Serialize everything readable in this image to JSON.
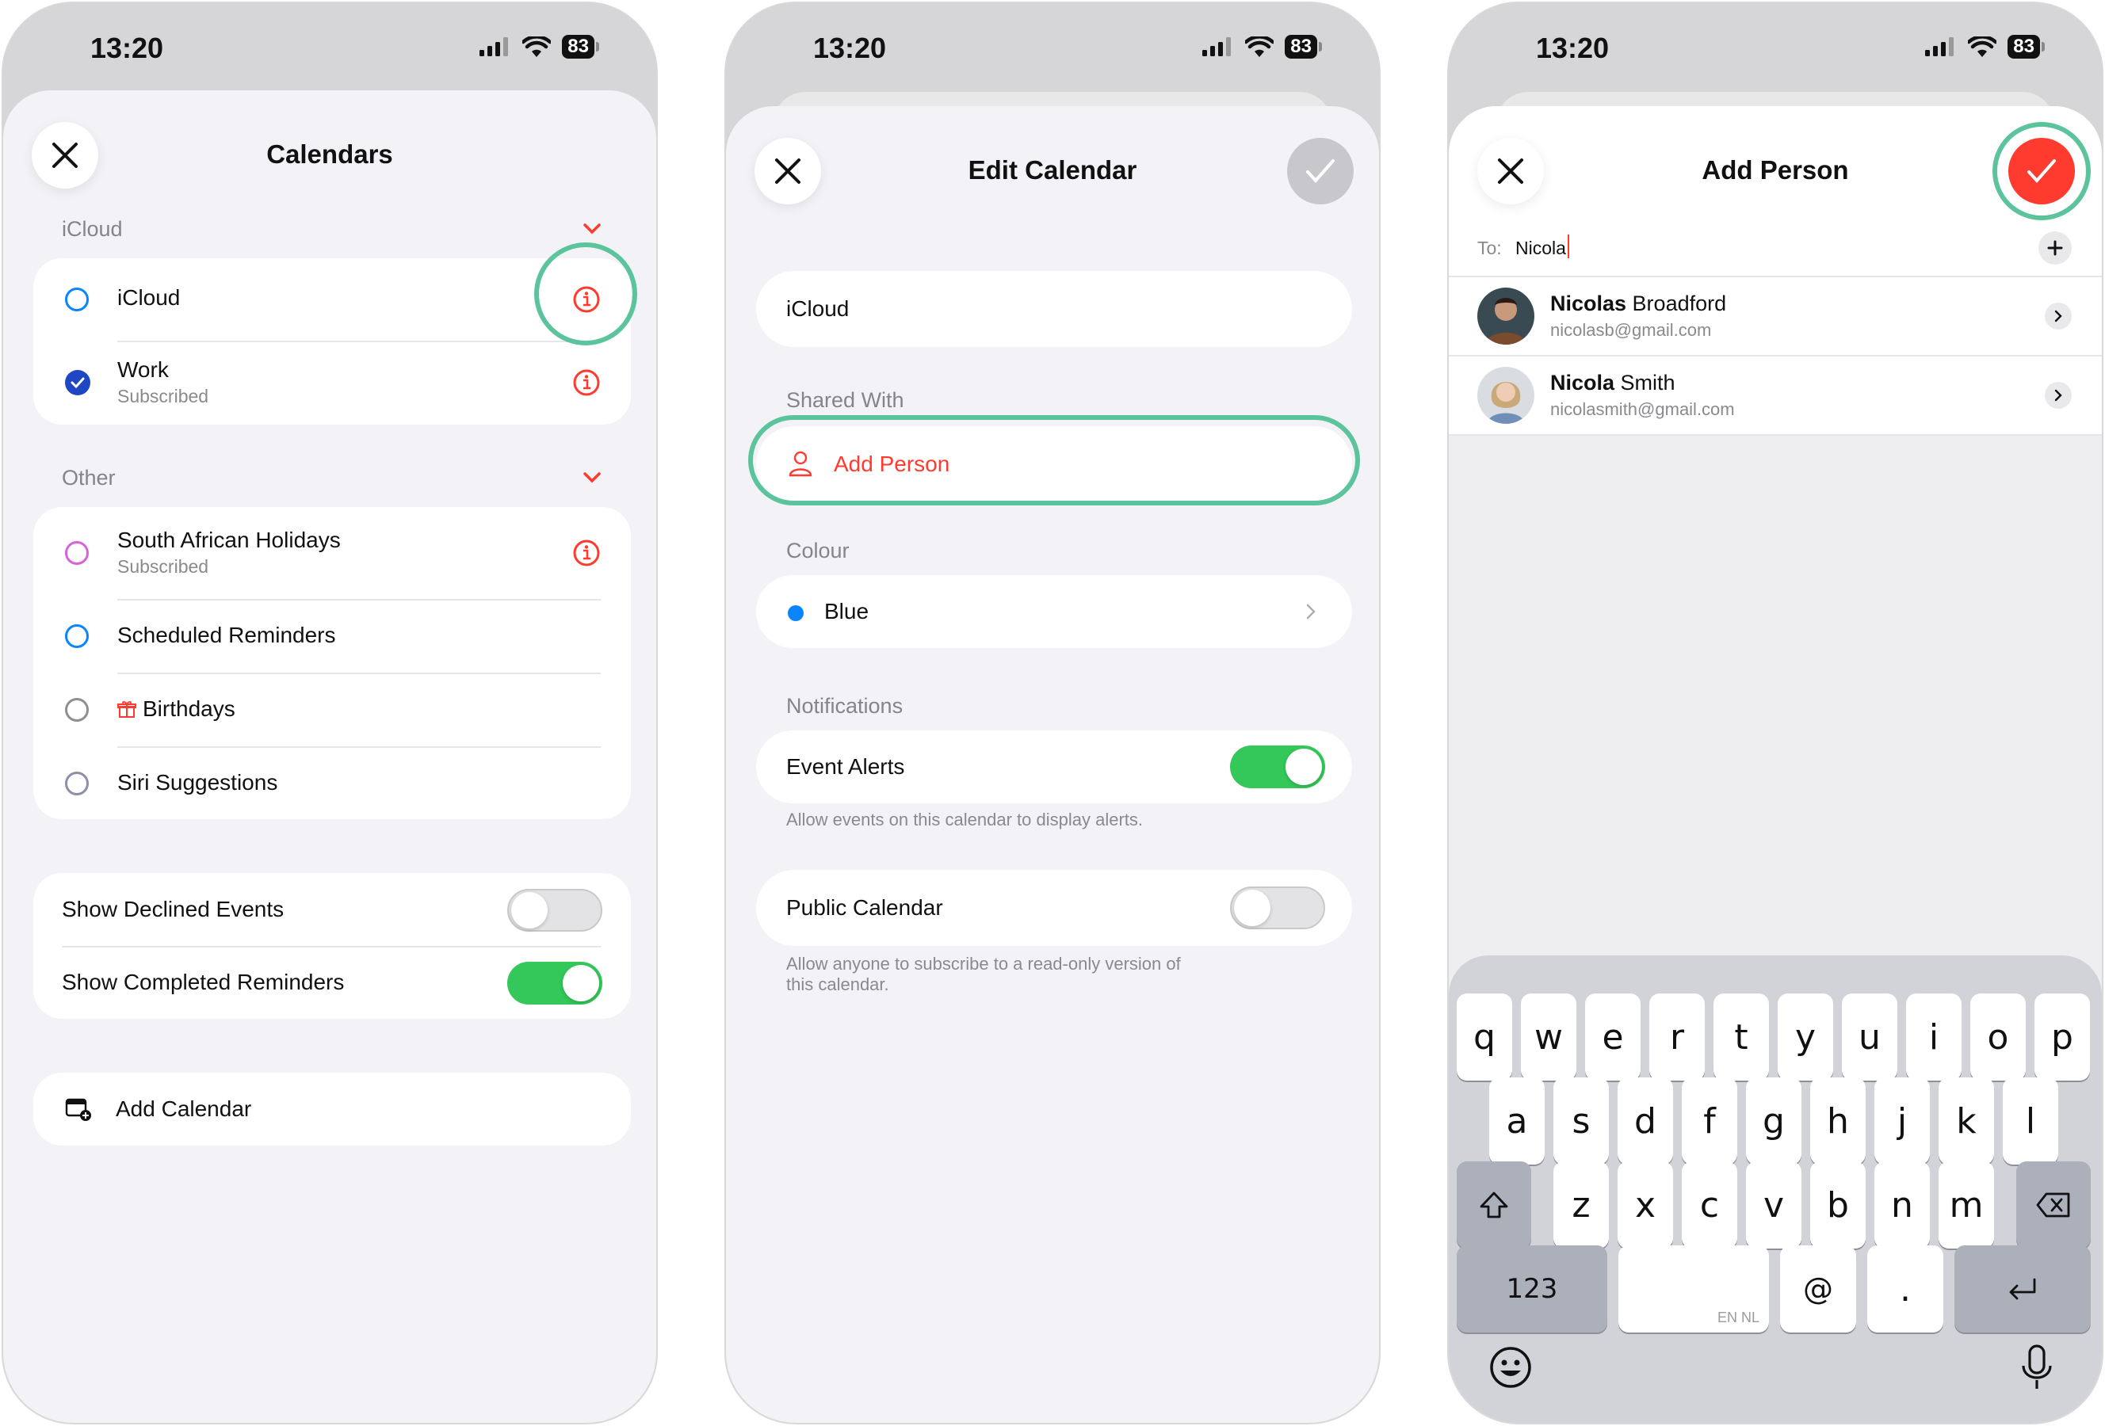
{
  "status": {
    "time": "13:20",
    "battery": "83"
  },
  "calendars": {
    "title": "Calendars",
    "icloud_section": "iCloud",
    "icloud_items": [
      {
        "label": "iCloud",
        "sub": ""
      },
      {
        "label": "Work",
        "sub": "Subscribed"
      }
    ],
    "other_section": "Other",
    "other_items": [
      {
        "label": "South African Holidays",
        "sub": "Subscribed"
      },
      {
        "label": "Scheduled Reminders",
        "sub": ""
      },
      {
        "label": "Birthdays",
        "sub": ""
      },
      {
        "label": "Siri Suggestions",
        "sub": ""
      }
    ],
    "toggles": [
      {
        "label": "Show Declined Events",
        "on": false
      },
      {
        "label": "Show Completed Reminders",
        "on": true
      }
    ],
    "add_calendar": "Add Calendar"
  },
  "edit_calendar": {
    "title": "Edit Calendar",
    "name_value": "iCloud",
    "shared_with_label": "Shared With",
    "add_person": "Add Person",
    "colour_label": "Colour",
    "colour_value": "Blue",
    "notifications_label": "Notifications",
    "event_alerts": "Event Alerts",
    "event_alerts_on": true,
    "event_alerts_note": "Allow events on this calendar to display alerts.",
    "public_calendar": "Public Calendar",
    "public_calendar_on": false,
    "public_note_1": "Allow anyone to subscribe to a read-only version of",
    "public_note_2": "this calendar."
  },
  "add_person": {
    "title": "Add Person",
    "to_label": "To:",
    "to_value": "Nicola",
    "contacts": [
      {
        "first": "Nicolas",
        "last": " Broadford",
        "email": "nicolasb@gmail.com"
      },
      {
        "first": "Nicola",
        "last": " Smith",
        "email": "nicolasmith@gmail.com"
      }
    ]
  },
  "keyboard": {
    "row1": [
      "q",
      "w",
      "e",
      "r",
      "t",
      "y",
      "u",
      "i",
      "o",
      "p"
    ],
    "row2": [
      "a",
      "s",
      "d",
      "f",
      "g",
      "h",
      "j",
      "k",
      "l"
    ],
    "row3": [
      "z",
      "x",
      "c",
      "v",
      "b",
      "n",
      "m"
    ],
    "numbers": "123",
    "lang": "EN NL",
    "at": "@",
    "dot": "."
  },
  "colors": {
    "accent_red": "#ff3b30",
    "blue": "#0a84ff",
    "green_toggle": "#34c759",
    "highlight": "#5cc49c"
  },
  "icons": {
    "close": "close-icon",
    "info": "info-icon",
    "checkmark": "checkmark-icon",
    "chevron": "chevron-right-icon",
    "person": "person-icon",
    "gift": "gift-icon",
    "calendar_add": "calendar-add-icon",
    "plus": "plus-icon",
    "shift": "shift-icon",
    "backspace": "backspace-icon",
    "return": "return-icon",
    "emoji": "emoji-icon",
    "mic": "microphone-icon"
  }
}
